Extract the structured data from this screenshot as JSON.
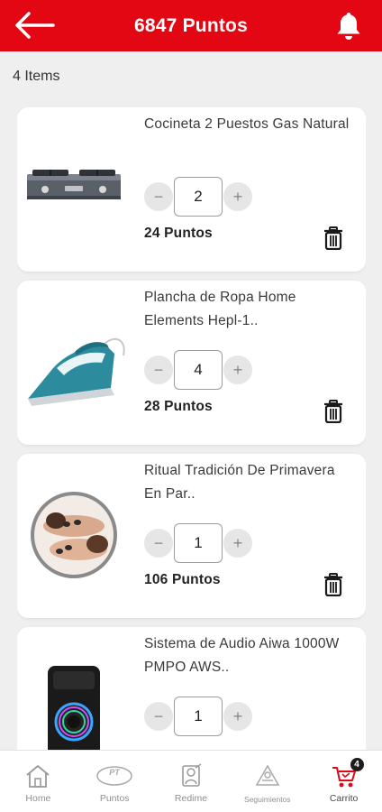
{
  "header": {
    "title": "6847 Puntos"
  },
  "cart": {
    "items_count": "4 Items"
  },
  "items": [
    {
      "name": "Cocineta 2 Puestos Gas Natural",
      "quantity": "2",
      "points": "24 Puntos",
      "image": "gas-stove-image"
    },
    {
      "name": "Plancha de Ropa Home Elements Hepl-1..",
      "quantity": "4",
      "points": "28 Puntos",
      "image": "clothes-iron-image"
    },
    {
      "name": "Ritual Tradición De Primavera En Par..",
      "quantity": "1",
      "points": "106 Puntos",
      "image": "spa-ritual-image"
    },
    {
      "name": "Sistema de Audio Aiwa 1000W PMPO AWS..",
      "quantity": "1",
      "points": "",
      "image": "speaker-image"
    }
  ],
  "controls": {
    "minus": "−",
    "plus": "+"
  },
  "nav": {
    "home": "Home",
    "puntos": "Puntos",
    "puntos_logo": "PT",
    "redime": "Redime",
    "seguimientos": "Seguimientos",
    "carrito": "Carrito",
    "cart_badge": "4"
  },
  "colors": {
    "brand": "#e30613",
    "background": "#efefef",
    "card": "#ffffff"
  }
}
